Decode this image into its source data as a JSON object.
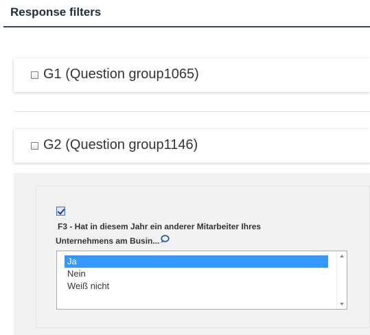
{
  "page": {
    "title": "Response filters"
  },
  "groups": [
    {
      "label": "G1 (Question group1065)",
      "checked": false
    },
    {
      "label": "G2 (Question group1146)",
      "checked": false
    }
  ],
  "question": {
    "checked": true,
    "text_line1": "F3 - Hat in diesem Jahr ein anderer Mitarbeiter Ihres",
    "text_line2": "Unternehmens am Busin...",
    "comment_icon": "speech-bubble-icon",
    "options": [
      {
        "label": "Ja",
        "selected": true
      },
      {
        "label": "Nein",
        "selected": false
      },
      {
        "label": "Weiß nicht",
        "selected": false
      }
    ]
  },
  "colors": {
    "header_border": "#34495e",
    "selection": "#3399ff",
    "comment_icon": "#1f5fa8",
    "panel_background": "#f2f2f2"
  }
}
